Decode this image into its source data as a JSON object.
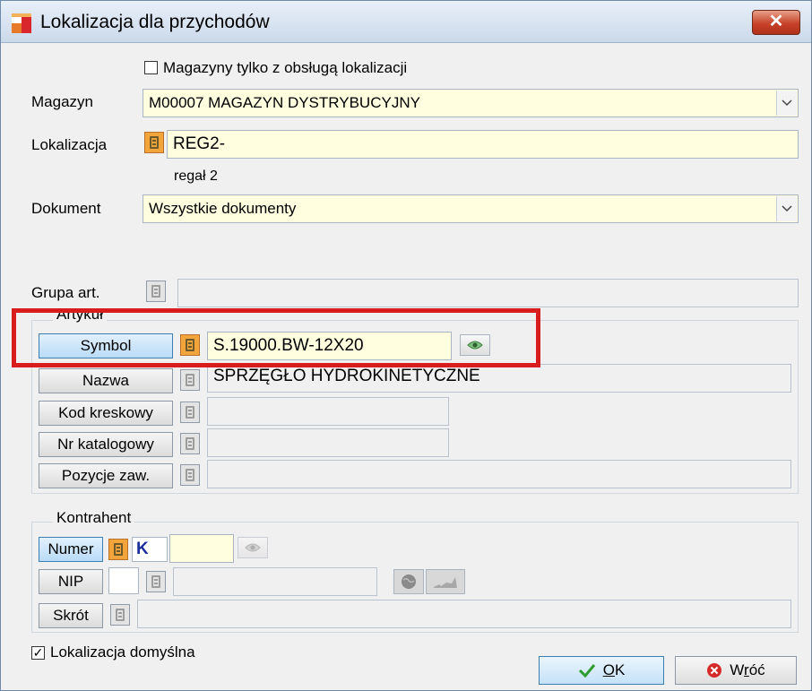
{
  "window": {
    "title": "Lokalizacja dla przychodów",
    "close_symbol": "✕"
  },
  "warehouses_only_checkbox": {
    "label": "Magazyny tylko z obsługą lokalizacji",
    "checked": false
  },
  "magazyn": {
    "label": "Magazyn",
    "value": "M00007 MAGAZYN DYSTRYBUCYJNY"
  },
  "lokalizacja": {
    "label": "Lokalizacja",
    "value": "REG2-",
    "description": "regał 2"
  },
  "dokument": {
    "label": "Dokument",
    "value": "Wszystkie dokumenty"
  },
  "grupa": {
    "label": "Grupa art.",
    "value": ""
  },
  "artykul": {
    "group_label": "Artykuł",
    "symbol_button": "Symbol",
    "symbol_value": "S.19000.BW-12X20",
    "nazwa_button": "Nazwa",
    "nazwa_value": "SPRZĘGŁO HYDROKINETYCZNE",
    "kod_button": "Kod kreskowy",
    "kod_value": "",
    "nr_button": "Nr katalogowy",
    "nr_value": "",
    "pozycje_button": "Pozycje zaw.",
    "pozycje_value": ""
  },
  "kontrahent": {
    "group_label": "Kontrahent",
    "numer_button": "Numer",
    "k_label": "K",
    "numer_value": "",
    "nip_button": "NIP",
    "nip_value": "",
    "skrot_button": "Skrót",
    "skrot_value": ""
  },
  "default_location_checkbox": {
    "label": "Lokalizacja domyślna",
    "checked": true,
    "check_symbol": "✓"
  },
  "buttons": {
    "ok_underlined": "O",
    "ok_rest": "K",
    "back_prefix": "W",
    "back_underlined": "r",
    "back_suffix": "óć"
  },
  "colors": {
    "field_yellow": "#ffffe0",
    "highlight_red": "#d91c1c",
    "selected_blue": "#b9dbf7"
  }
}
